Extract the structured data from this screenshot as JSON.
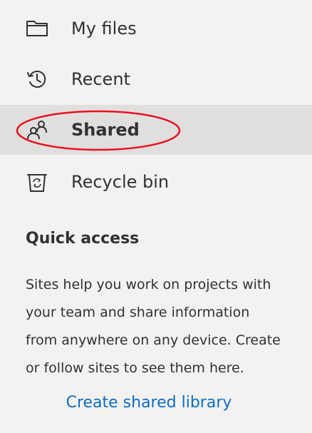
{
  "nav": {
    "items": [
      {
        "label": "My files",
        "icon": "folder-icon"
      },
      {
        "label": "Recent",
        "icon": "history-clock-icon"
      },
      {
        "label": "Shared",
        "icon": "people-shared-icon",
        "selected": true
      },
      {
        "label": "Recycle bin",
        "icon": "recycle-bin-icon"
      }
    ],
    "annotation": {
      "shape": "ellipse",
      "color": "#e81123",
      "target": "Shared"
    }
  },
  "quick_access": {
    "title": "Quick access",
    "lines": [
      "Sites help you work on projects with",
      "your team and share information",
      "from anywhere on any device. Create",
      "or follow sites to see them here."
    ],
    "link_label": "Create shared library"
  },
  "colors": {
    "background": "#f3f2f1",
    "selected_background": "#e1dfdd",
    "text": "#323130",
    "link": "#0f6cbd",
    "annotation": "#e81123"
  }
}
